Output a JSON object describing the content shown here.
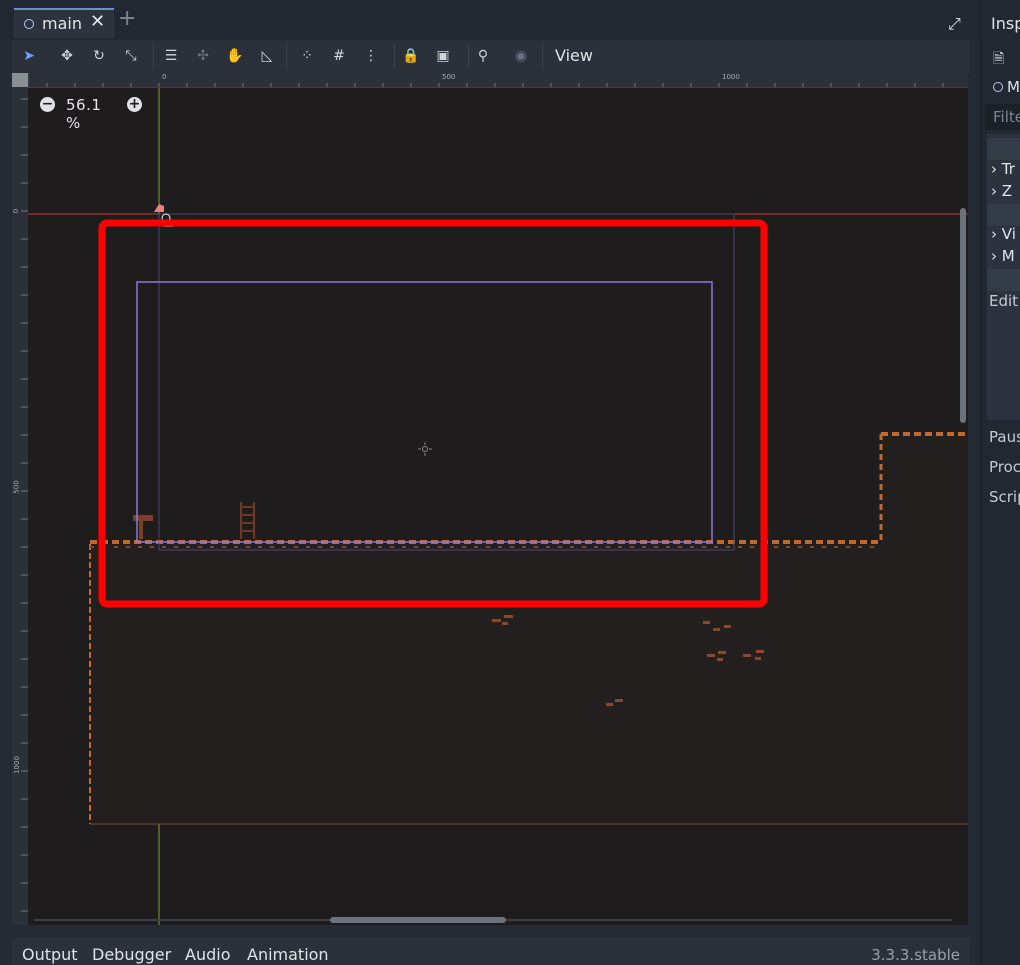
{
  "tabbar": {
    "tab_name": "main",
    "close_glyph": "✕",
    "add_glyph": "+",
    "distraction_free_icon": "expand-icon"
  },
  "toolbar": {
    "tools": [
      {
        "name": "select-tool-icon",
        "glyph": "➤",
        "active": true
      },
      {
        "name": "move-tool-icon",
        "glyph": "✥"
      },
      {
        "name": "rotate-tool-icon",
        "glyph": "↻"
      },
      {
        "name": "scale-tool-icon",
        "glyph": "⤡"
      },
      {
        "name": "list-select-icon",
        "glyph": "☰"
      },
      {
        "name": "pivot-tool-icon",
        "glyph": "✣",
        "dim": true
      },
      {
        "name": "pan-tool-icon",
        "glyph": "✋"
      },
      {
        "name": "ruler-tool-icon",
        "glyph": "◺"
      },
      {
        "name": "smart-snap-icon",
        "glyph": "⁘"
      },
      {
        "name": "grid-snap-icon",
        "glyph": "#"
      },
      {
        "name": "more-options-icon",
        "glyph": "⋮"
      },
      {
        "name": "lock-icon",
        "glyph": "🔒"
      },
      {
        "name": "group-icon",
        "glyph": "▣"
      },
      {
        "name": "bone-icon",
        "glyph": "⚲"
      },
      {
        "name": "camera-icon",
        "glyph": "◉",
        "dim": true
      }
    ],
    "view_label": "View"
  },
  "rulers": {
    "horizontal_labels": [
      "0",
      "500",
      "1000"
    ],
    "vertical_labels": [
      "0",
      "500",
      "1000"
    ]
  },
  "viewport": {
    "zoom_value": "56.1 %",
    "zoom_out_glyph": "−",
    "zoom_in_glyph": "+"
  },
  "bottom_panel": {
    "tabs": [
      "Output",
      "Debugger",
      "Audio",
      "Animation"
    ],
    "version": "3.3.3.stable"
  },
  "inspector": {
    "title": "Insp",
    "node_label": "M",
    "filter_placeholder": "Filte",
    "rows": [
      "Tr",
      "Z",
      "Vi",
      "M"
    ],
    "edit_label": "Edit",
    "labels": [
      "Paus",
      "Proc",
      "Scrip"
    ]
  },
  "colors": {
    "highlight_box": "#ff0000",
    "camera_rect": "#8b78d6",
    "ground": "#c0692f",
    "origin_x_axis": "#c43a3a",
    "origin_y_axis": "#7fa23a"
  }
}
